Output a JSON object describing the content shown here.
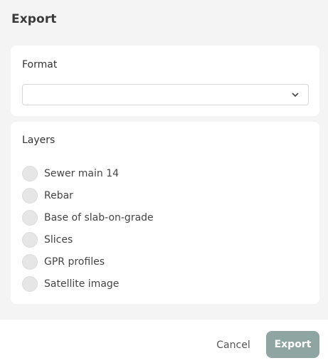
{
  "dialog": {
    "title": "Export"
  },
  "format": {
    "label": "Format",
    "selected_value": ""
  },
  "layers": {
    "label": "Layers",
    "items": [
      {
        "label": "Sewer main 14",
        "checked": false
      },
      {
        "label": "Rebar",
        "checked": false
      },
      {
        "label": "Base of slab-on-grade",
        "checked": false
      },
      {
        "label": "Slices",
        "checked": false
      },
      {
        "label": "GPR profiles",
        "checked": false
      },
      {
        "label": "Satellite image",
        "checked": false
      }
    ]
  },
  "footer": {
    "cancel_label": "Cancel",
    "export_label": "Export"
  },
  "colors": {
    "export_button": "#8fa5a1",
    "background": "#f4f4f4",
    "card": "#ffffff"
  },
  "icons": {
    "select": "chevron-down-icon",
    "layer_option": "radio-unchecked"
  }
}
